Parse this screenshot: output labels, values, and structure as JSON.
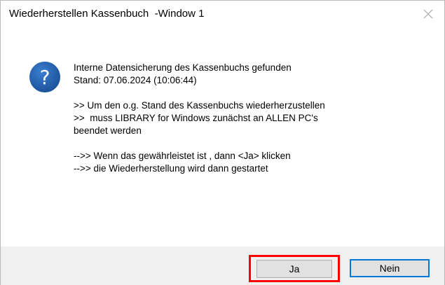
{
  "window": {
    "title": "Wiederherstellen Kassenbuch  -Window 1"
  },
  "icons": {
    "dialog_icon": "question-icon",
    "close_icon": "close-icon"
  },
  "message": {
    "lines": [
      "Interne Datensicherung des Kassenbuchs gefunden",
      "Stand: 07.06.2024 (10:06:44)",
      "",
      ">> Um den o.g. Stand des Kassenbuchs wiederherzustellen",
      ">>  muss LIBRARY for Windows zunächst an ALLEN PC's",
      "beendet werden",
      "",
      "-->> Wenn das gewährleistet ist , dann <Ja> klicken",
      "-->> die Wiederherstellung wird dann gestartet"
    ]
  },
  "buttons": {
    "yes_label": "Ja",
    "no_label": "Nein"
  },
  "colors": {
    "icon_blue": "#1f5fa8",
    "highlight_red": "#ff0000",
    "focus_blue": "#0078d7",
    "footer_bg": "#f0f0f0"
  }
}
